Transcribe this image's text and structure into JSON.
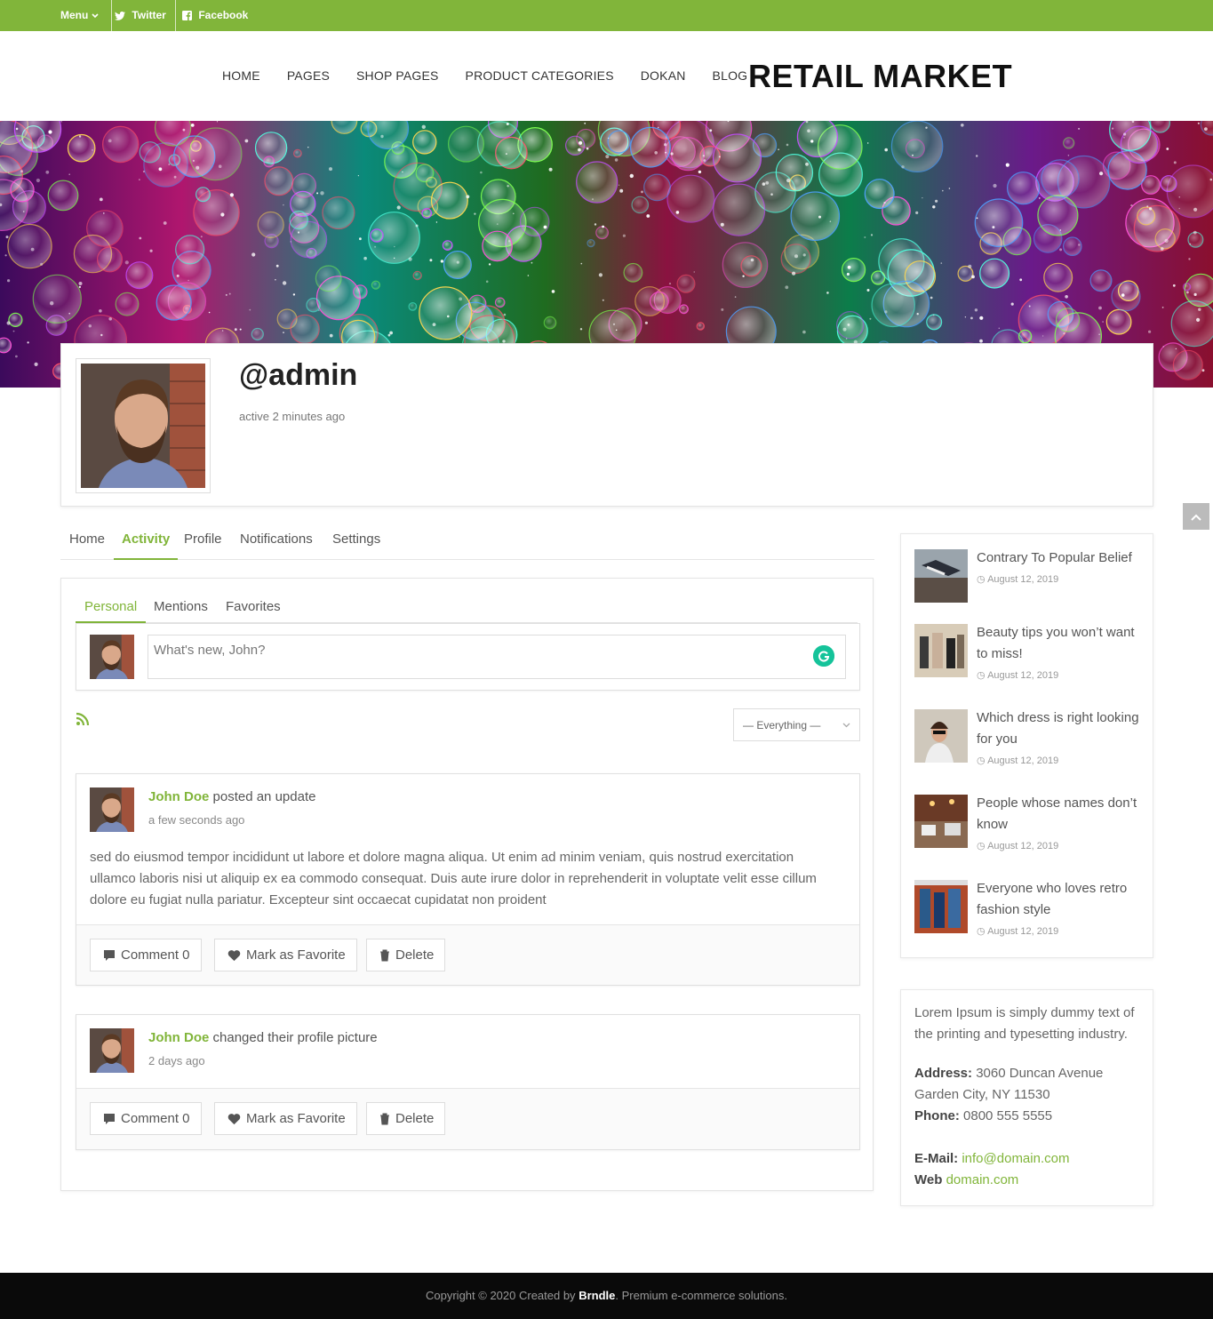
{
  "topbar": {
    "menu_label": "Menu",
    "twitter_label": "Twitter",
    "facebook_label": "Facebook"
  },
  "nav": {
    "items": [
      "HOME",
      "PAGES",
      "SHOP PAGES",
      "PRODUCT CATEGORIES",
      "DOKAN",
      "BLOG"
    ],
    "logo": "RETAIL MARKET"
  },
  "profile": {
    "username": "@admin",
    "active_time": "active 2 minutes ago"
  },
  "tabs": [
    "Home",
    "Activity",
    "Profile",
    "Notifications",
    "Settings"
  ],
  "subtabs": [
    "Personal",
    "Mentions",
    "Favorites"
  ],
  "post_form": {
    "placeholder": "What's new, John?"
  },
  "filter": {
    "selected": "— Everything —"
  },
  "entries": [
    {
      "user": "John Doe",
      "action": "posted an update",
      "time": "a few seconds ago",
      "body": "sed do eiusmod tempor incididunt ut labore et dolore magna aliqua. Ut enim ad minim veniam, quis nostrud exercitation ullamco laboris nisi ut aliquip ex ea commodo consequat. Duis aute irure dolor in reprehenderit in voluptate velit esse cillum dolore eu fugiat nulla pariatur. Excepteur sint occaecat cupidatat non proident",
      "comment_label": "Comment 0",
      "favorite_label": "Mark as Favorite",
      "delete_label": "Delete"
    },
    {
      "user": "John Doe",
      "action": "changed their profile picture",
      "time": "2 days ago",
      "comment_label": "Comment 0",
      "favorite_label": "Mark as Favorite",
      "delete_label": "Delete"
    }
  ],
  "sidebar_posts": [
    {
      "title": "Contrary To Popular Belief",
      "date": "August 12, 2019"
    },
    {
      "title": "Beauty tips you won’t want to miss!",
      "date": "August 12, 2019"
    },
    {
      "title": "Which dress is right looking for you",
      "date": "August 12, 2019"
    },
    {
      "title": "People whose names don’t know",
      "date": "August 12, 2019"
    },
    {
      "title": "Everyone who loves retro fashion style",
      "date": "August 12, 2019"
    }
  ],
  "sidebar_info": {
    "intro": "Lorem Ipsum is simply dummy text of the printing and typesetting industry.",
    "address_label": "Address:",
    "address_line1": "3060 Duncan Avenue",
    "address_line2": "Garden City, NY 11530",
    "phone_label": "Phone:",
    "phone": "0800 555 5555",
    "email_label": "E-Mail:",
    "email": "info@domain.com",
    "web_label": "Web",
    "web": "domain.com"
  },
  "footer": {
    "prefix": "Copyright © 2020 Created by",
    "brand": "Brndle",
    "suffix": ". Premium e-commerce solutions."
  },
  "colors": {
    "accent": "#81b53a",
    "footer_bg": "#0a0a0a",
    "grammarly": "#15c39a"
  }
}
